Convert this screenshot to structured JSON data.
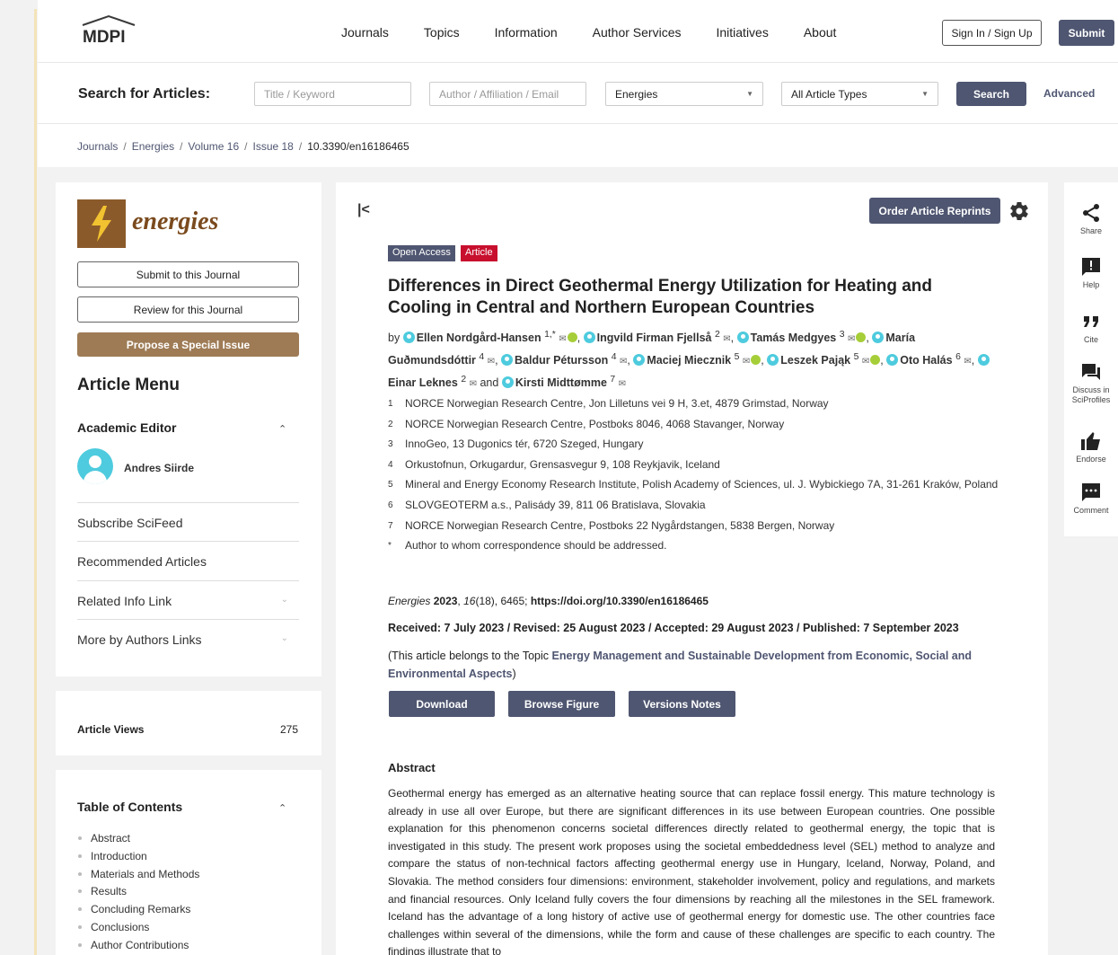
{
  "nav": {
    "logo": "MDPI",
    "links": [
      "Journals",
      "Topics",
      "Information",
      "Author Services",
      "Initiatives",
      "About"
    ],
    "signin": "Sign In / Sign Up",
    "submit": "Submit"
  },
  "search": {
    "label": "Search for Articles:",
    "title_placeholder": "Title / Keyword",
    "author_placeholder": "Author / Affiliation / Email",
    "journal_value": "Energies",
    "type_value": "All Article Types",
    "search_button": "Search",
    "advanced": "Advanced"
  },
  "breadcrumb": [
    "Journals",
    "Energies",
    "Volume 16",
    "Issue 18",
    "10.3390/en16186465"
  ],
  "sidebar": {
    "journal_name": "energies",
    "submit_journal": "Submit to this Journal",
    "review_journal": "Review for this Journal",
    "propose_issue": "Propose a Special Issue",
    "article_menu": "Article Menu",
    "academic_editor": "Academic Editor",
    "editor_name": "Andres Siirde",
    "menu_items": [
      "Subscribe SciFeed",
      "Recommended Articles",
      "Related Info Link",
      "More by Authors Links"
    ],
    "views_label": "Article Views",
    "views_value": "275",
    "toc_title": "Table of Contents",
    "toc_items": [
      "Abstract",
      "Introduction",
      "Materials and Methods",
      "Results",
      "Concluding Remarks",
      "Conclusions",
      "Author Contributions"
    ]
  },
  "article": {
    "order_reprints": "Order Article Reprints",
    "badge_open": "Open Access",
    "badge_type": "Article",
    "title": "Differences in Direct Geothermal Energy Utilization for Heating and Cooling in Central and Northern European Countries",
    "by": "by",
    "authors": [
      {
        "name": "Ellen Nordgård-Hansen",
        "sup": "1,*",
        "orcid": true,
        "sep": ","
      },
      {
        "name": "Ingvild Firman Fjellså",
        "sup": "2",
        "orcid": false,
        "sep": ","
      },
      {
        "name": "Tamás Medgyes",
        "sup": "3",
        "orcid": true,
        "sep": ","
      },
      {
        "name": "María Guðmundsdóttir",
        "sup": "4",
        "orcid": false,
        "sep": ","
      },
      {
        "name": "Baldur Pétursson",
        "sup": "4",
        "orcid": false,
        "sep": ","
      },
      {
        "name": "Maciej Miecznik",
        "sup": "5",
        "orcid": true,
        "sep": ","
      },
      {
        "name": "Leszek Pająk",
        "sup": "5",
        "orcid": true,
        "sep": ","
      },
      {
        "name": "Oto Halás",
        "sup": "6",
        "orcid": false,
        "sep": ","
      },
      {
        "name": "Einar Leknes",
        "sup": "2",
        "orcid": false,
        "sep": " and"
      },
      {
        "name": "Kirsti Midttømme",
        "sup": "7",
        "orcid": false,
        "sep": ""
      }
    ],
    "affiliations": [
      {
        "num": "1",
        "text": "NORCE Norwegian Research Centre, Jon Lilletuns vei 9 H, 3.et, 4879 Grimstad, Norway"
      },
      {
        "num": "2",
        "text": "NORCE Norwegian Research Centre, Postboks 8046, 4068 Stavanger, Norway"
      },
      {
        "num": "3",
        "text": "InnoGeo, 13 Dugonics tér, 6720 Szeged, Hungary"
      },
      {
        "num": "4",
        "text": "Orkustofnun, Orkugardur, Grensasvegur 9, 108 Reykjavik, Iceland"
      },
      {
        "num": "5",
        "text": "Mineral and Energy Economy Research Institute, Polish Academy of Sciences, ul. J. Wybickiego 7A, 31-261 Kraków, Poland"
      },
      {
        "num": "6",
        "text": "SLOVGEOTERM a.s., Palisády 39, 811 06 Bratislava, Slovakia"
      },
      {
        "num": "7",
        "text": "NORCE Norwegian Research Centre, Postboks 22 Nygårdstangen, 5838 Bergen, Norway"
      },
      {
        "num": "*",
        "text": "Author to whom correspondence should be addressed."
      }
    ],
    "cite_journal": "Energies",
    "cite_year": "2023",
    "cite_volume": "16",
    "cite_rest": "(18), 6465;",
    "cite_doi": "https://doi.org/10.3390/en16186465",
    "dates": "Received: 7 July 2023 / Revised: 25 August 2023 / Accepted: 29 August 2023 / Published: 7 September 2023",
    "topic_prefix": "(This article belongs to the Topic",
    "topic_link": "Energy Management and Sustainable Development from Economic, Social and Environmental Aspects",
    "topic_suffix": ")",
    "download": "Download",
    "browse_figure": "Browse Figure",
    "versions_notes": "Versions Notes",
    "abstract_title": "Abstract",
    "abstract": "Geothermal energy has emerged as an alternative heating source that can replace fossil energy. This mature technology is already in use all over Europe, but there are significant differences in its use between European countries. One possible explanation for this phenomenon concerns societal differences directly related to geothermal energy, the topic that is investigated in this study. The present work proposes using the societal embeddedness level (SEL) method to analyze and compare the status of non-technical factors affecting geothermal energy use in Hungary, Iceland, Norway, Poland, and Slovakia. The method considers four dimensions: environment, stakeholder involvement, policy and regulations, and markets and financial resources. Only Iceland fully covers the four dimensions by reaching all the milestones in the SEL framework. Iceland has the advantage of a long history of active use of geothermal energy for domestic use. The other countries face challenges within several of the dimensions, while the form and cause of these challenges are specific to each country. The findings illustrate that to"
  },
  "side_tools": [
    {
      "icon": "share-icon",
      "label": "Share"
    },
    {
      "icon": "help-icon",
      "label": "Help"
    },
    {
      "icon": "cite-icon",
      "label": "Cite"
    },
    {
      "icon": "discuss-icon",
      "label": "Discuss in SciProfiles"
    },
    {
      "icon": "endorse-icon",
      "label": "Endorse"
    },
    {
      "icon": "comment-icon",
      "label": "Comment"
    }
  ]
}
